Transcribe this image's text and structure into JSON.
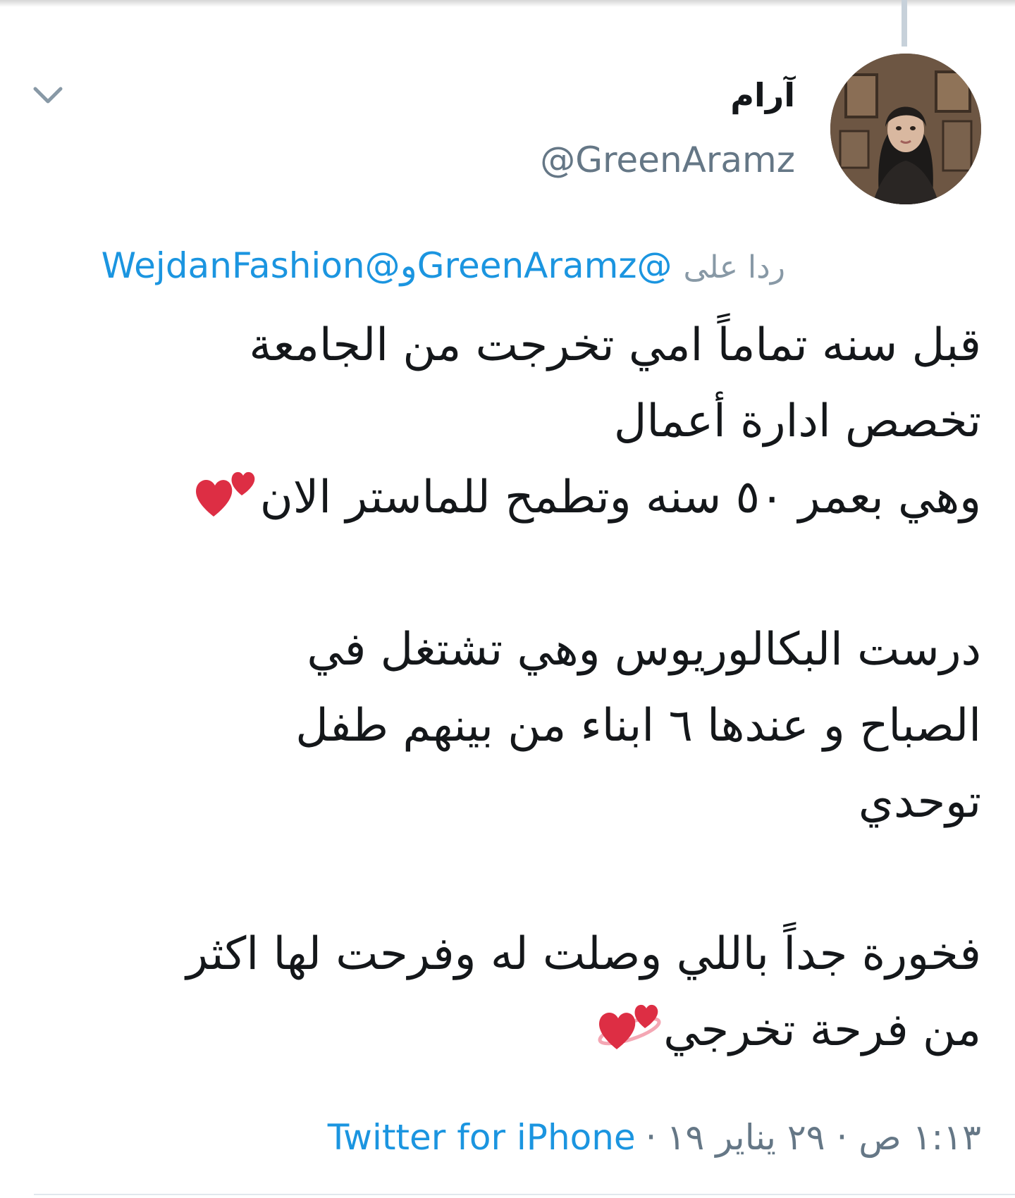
{
  "user": {
    "display_name": "آرام",
    "handle": "@GreenAramz",
    "avatar_icon": "profile-photo"
  },
  "reply": {
    "label": "ردا على",
    "mention_1": "@GreenAramz",
    "conjunction": "و",
    "mention_2": "@WejdanFashion"
  },
  "tweet": {
    "p1_line1": "قبل سنه تماماً امي تخرجت من الجامعة",
    "p1_line2": "تخصص ادارة أعمال",
    "p1_line3": "وهي بعمر ٥٠ سنه  وتطمح للماستر الان",
    "p2_line1": "درست البكالوريوس وهي تشتغل في",
    "p2_line2": "الصباح و عندها ٦ ابناء من بينهم طفل",
    "p2_line3": "توحدي",
    "p3_line1": "فخورة جداً باللي وصلت له وفرحت لها اكثر",
    "p3_line2": "من فرحة تخرجي"
  },
  "meta": {
    "timestamp": "١:١٣ ص · ٢٩ يناير ١٩",
    "separator": "·",
    "source": "Twitter for iPhone"
  },
  "colors": {
    "link": "#1b95e0",
    "muted": "#657786",
    "text": "#14171a",
    "heart": "#dd2e44"
  },
  "icons": {
    "menu": "chevron-down-icon",
    "emoji": "two-hearts-icon"
  }
}
